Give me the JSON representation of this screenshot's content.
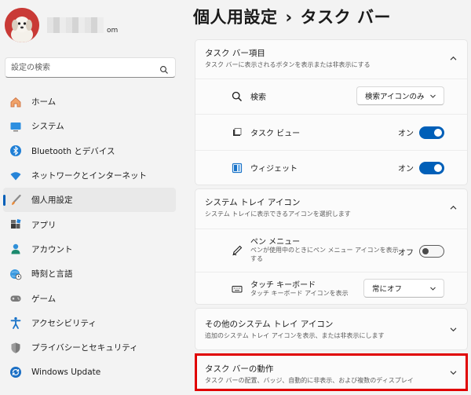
{
  "user": {
    "email_suffix": "om"
  },
  "search": {
    "placeholder": "設定の検索",
    "icon": "search-icon"
  },
  "nav": {
    "items": [
      {
        "label": "ホーム",
        "icon": "home-icon"
      },
      {
        "label": "システム",
        "icon": "system-icon"
      },
      {
        "label": "Bluetooth とデバイス",
        "icon": "bluetooth-icon"
      },
      {
        "label": "ネットワークとインターネット",
        "icon": "wifi-icon"
      },
      {
        "label": "個人用設定",
        "icon": "brush-icon",
        "selected": true
      },
      {
        "label": "アプリ",
        "icon": "apps-icon"
      },
      {
        "label": "アカウント",
        "icon": "account-icon"
      },
      {
        "label": "時刻と言語",
        "icon": "globe-clock-icon"
      },
      {
        "label": "ゲーム",
        "icon": "gamepad-icon"
      },
      {
        "label": "アクセシビリティ",
        "icon": "accessibility-icon"
      },
      {
        "label": "プライバシーとセキュリティ",
        "icon": "shield-icon"
      },
      {
        "label": "Windows Update",
        "icon": "windows-update-icon"
      }
    ]
  },
  "header": {
    "parent": "個人用設定",
    "separator": "›",
    "current": "タスク バー"
  },
  "taskbar_items": {
    "title": "タスク バー項目",
    "subtitle": "タスク バーに表示されるボタンを表示または非表示にする",
    "search": {
      "label": "検索",
      "value": "検索アイコンのみ"
    },
    "task_view": {
      "label": "タスク ビュー",
      "state": "オン",
      "on": true
    },
    "widgets": {
      "label": "ウィジェット",
      "state": "オン",
      "on": true
    }
  },
  "system_tray": {
    "title": "システム トレイ アイコン",
    "subtitle": "システム トレイに表示できるアイコンを選択します",
    "pen_menu": {
      "label": "ペン メニュー",
      "description": "ペンが使用中のときにペン メニュー アイコンを表示する",
      "state": "オフ",
      "on": false
    },
    "touch_keyboard": {
      "label": "タッチ キーボード",
      "description": "タッチ キーボード アイコンを表示",
      "value": "常にオフ"
    }
  },
  "other_tray": {
    "title": "その他のシステム トレイ アイコン",
    "subtitle": "追加のシステム トレイ アイコンを表示、または非表示にします"
  },
  "taskbar_behavior": {
    "title": "タスク バーの動作",
    "subtitle": "タスク バーの配置、バッジ、自動的に非表示、および複数のディスプレイ"
  },
  "colors": {
    "accent": "#005fb8",
    "highlight": "#e00000",
    "background": "#f3f3f3",
    "card": "#fbfbfb"
  }
}
